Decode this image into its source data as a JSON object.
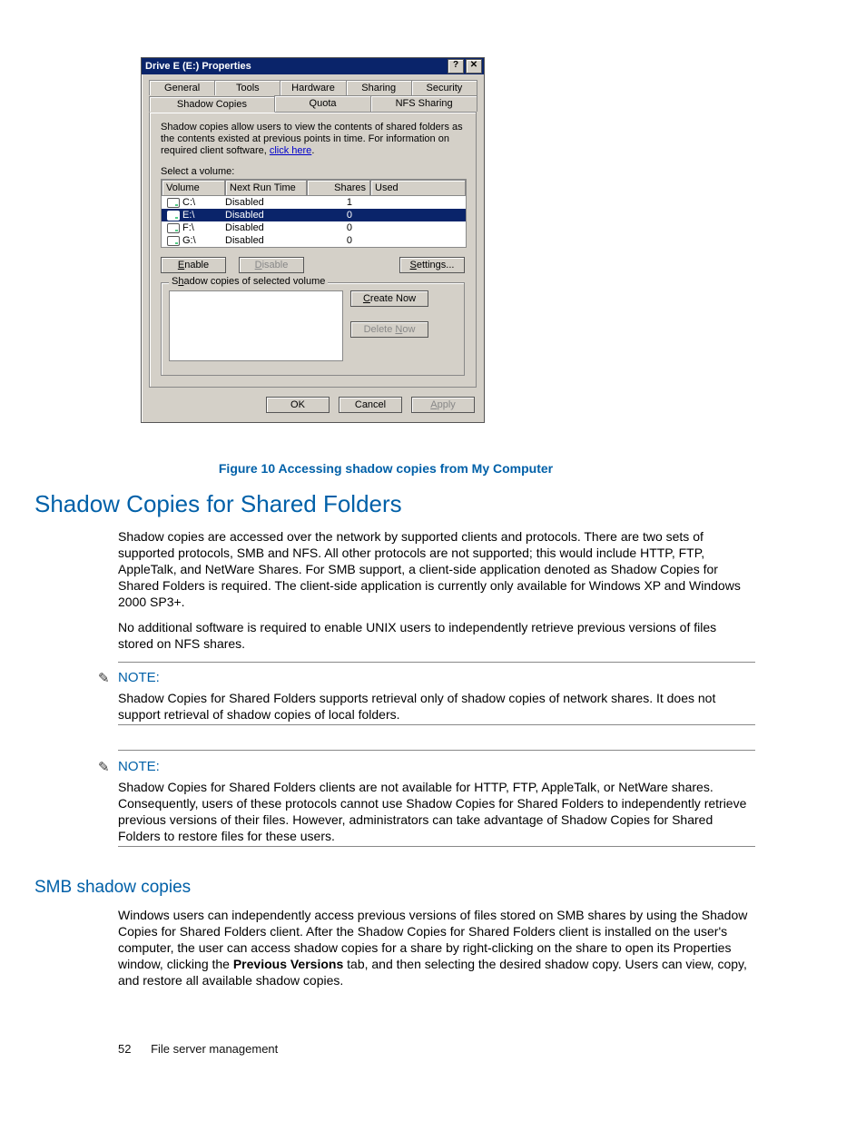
{
  "dialog": {
    "title": "Drive E (E:) Properties",
    "help_btn": "?",
    "close_btn": "✕",
    "tabs_row1": [
      "General",
      "Tools",
      "Hardware",
      "Sharing",
      "Security"
    ],
    "tabs_row2": [
      "Shadow Copies",
      "Quota",
      "NFS Sharing"
    ],
    "active_tab": "Shadow Copies",
    "description_pre": "Shadow copies allow users to view the contents of shared folders as the contents existed at previous points in time. For information on required client software, ",
    "description_link": "click here",
    "description_post": ".",
    "select_label": "Select a volume:",
    "columns": [
      "Volume",
      "Next Run Time",
      "Shares",
      "Used"
    ],
    "rows": [
      {
        "vol": "C:\\",
        "next": "Disabled",
        "shares": "1",
        "used": "",
        "selected": false
      },
      {
        "vol": "E:\\",
        "next": "Disabled",
        "shares": "0",
        "used": "",
        "selected": true
      },
      {
        "vol": "F:\\",
        "next": "Disabled",
        "shares": "0",
        "used": "",
        "selected": false
      },
      {
        "vol": "G:\\",
        "next": "Disabled",
        "shares": "0",
        "used": "",
        "selected": false
      }
    ],
    "enable_btn": "Enable",
    "disable_btn": "Disable",
    "settings_btn": "Settings...",
    "group_legend": "Shadow copies of selected volume",
    "create_btn": "Create Now",
    "delete_btn": "Delete Now",
    "ok_btn": "OK",
    "cancel_btn": "Cancel",
    "apply_btn": "Apply"
  },
  "caption": "Figure 10 Accessing shadow copies from My Computer",
  "heading1": "Shadow Copies for Shared Folders",
  "para1": "Shadow copies are accessed over the network by supported clients and protocols. There are two sets of supported protocols, SMB and NFS. All other protocols are not supported; this would include HTTP, FTP, AppleTalk, and NetWare Shares. For SMB support, a client-side application denoted as Shadow Copies for Shared Folders is required. The client-side application is currently only available for Windows XP and Windows 2000 SP3+.",
  "para2": "No additional software is required to enable UNIX users to independently retrieve previous versions of files stored on NFS shares.",
  "note_label": "NOTE:",
  "note1": "Shadow Copies for Shared Folders supports retrieval only of shadow copies of network shares. It does not support retrieval of shadow copies of local folders.",
  "note2": "Shadow Copies for Shared Folders clients are not available for HTTP, FTP, AppleTalk, or NetWare shares. Consequently, users of these protocols cannot use Shadow Copies for Shared Folders to independently retrieve previous versions of their files. However, administrators can take advantage of Shadow Copies for Shared Folders to restore files for these users.",
  "heading2": "SMB shadow copies",
  "para3_pre": "Windows users can independently access previous versions of files stored on SMB shares by using the Shadow Copies for Shared Folders client. After the Shadow Copies for Shared Folders client is installed on the user's computer, the user can access shadow copies for a share by right-clicking on the share to open its Properties window, clicking the ",
  "para3_bold": "Previous Versions",
  "para3_post": " tab, and then selecting the desired shadow copy. Users can view, copy, and restore all available shadow copies.",
  "page_number": "52",
  "footer_text": "File server management"
}
